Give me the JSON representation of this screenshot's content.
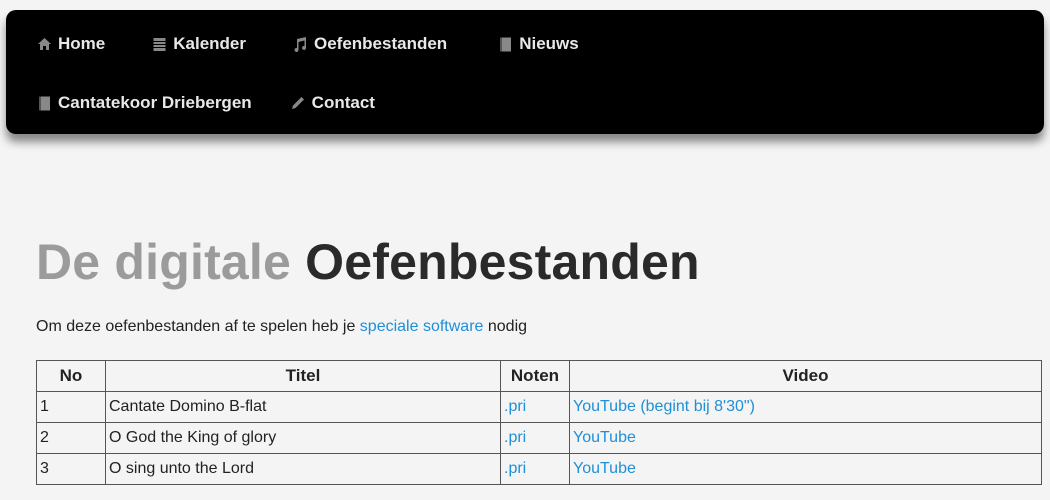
{
  "nav": {
    "row1": [
      {
        "label": "Home",
        "icon": "home-icon"
      },
      {
        "label": "Kalender",
        "icon": "calendar-icon"
      },
      {
        "label": "Oefenbestanden",
        "icon": "music-note-icon"
      },
      {
        "label": "Nieuws",
        "icon": "book-icon"
      }
    ],
    "row2": [
      {
        "label": "Cantatekoor Driebergen",
        "icon": "book-icon"
      },
      {
        "label": "Contact",
        "icon": "pencil-icon"
      }
    ]
  },
  "title": {
    "light": "De digitale",
    "dark": "Oefenbestanden"
  },
  "intro": {
    "before": "Om deze oefenbestanden af te spelen heb je ",
    "link": "speciale software",
    "after": " nodig"
  },
  "table": {
    "headers": [
      "No",
      "Titel",
      "Noten",
      "Video"
    ],
    "rows": [
      {
        "no": "1",
        "titel": "Cantate Domino B-flat",
        "noten": ".pri",
        "video": "YouTube (begint bij 8'30\")"
      },
      {
        "no": "2",
        "titel": "O God the King of glory",
        "noten": ".pri",
        "video": "YouTube"
      },
      {
        "no": "3",
        "titel": "O sing unto the Lord",
        "noten": ".pri",
        "video": "YouTube"
      }
    ]
  },
  "colors": {
    "link": "#1f8fd6",
    "navbar": "#000000",
    "title_light": "#9b9b9b",
    "title_dark": "#2a2a2a"
  }
}
